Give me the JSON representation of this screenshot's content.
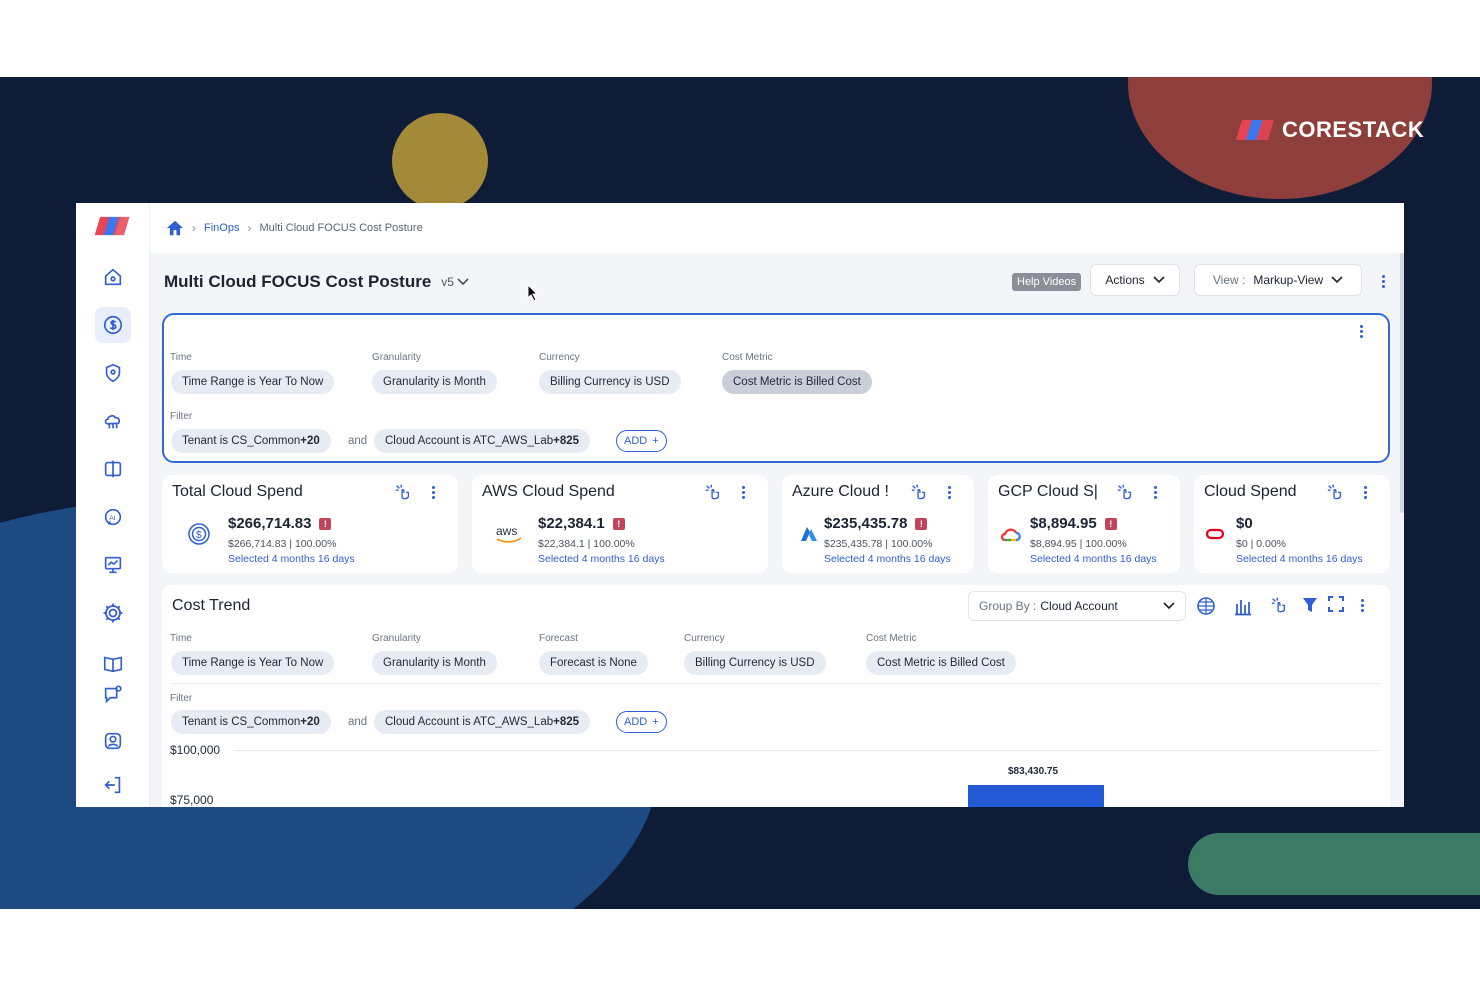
{
  "brand": {
    "name": "CORESTACK"
  },
  "breadcrumb": {
    "home_icon": "home-icon",
    "items": [
      "FinOps",
      "Multi Cloud FOCUS Cost Posture"
    ]
  },
  "page": {
    "title": "Multi Cloud FOCUS Cost Posture",
    "version": "v5",
    "help_videos": "Help Videos",
    "actions_label": "Actions",
    "view_prefix": "View :",
    "view_value": "Markup-View"
  },
  "sidebar": {
    "icons": [
      "home-icon",
      "dollar-icon",
      "shield-icon",
      "cloud-network-icon",
      "book-split-icon",
      "ai-chat-icon",
      "monitor-chart-icon",
      "gear-icon",
      "book-open-icon",
      "chat-settings-icon",
      "user-icon",
      "logout-icon"
    ],
    "active": "dollar-icon"
  },
  "filters": {
    "time_label": "Time",
    "time_chip": "Time Range is Year To Now",
    "granularity_label": "Granularity",
    "granularity_chip": "Granularity is Month",
    "currency_label": "Currency",
    "currency_chip": "Billing Currency is USD",
    "cost_metric_label": "Cost Metric",
    "cost_metric_chip": "Cost Metric is Billed Cost",
    "filter_label": "Filter",
    "tenant_chip_prefix": "Tenant is CS_Common",
    "tenant_chip_more": "+20",
    "and": "and",
    "account_chip_prefix": "Cloud Account is ATC_AWS_Lab",
    "account_chip_more": "+825",
    "add_label": "ADD"
  },
  "cards": [
    {
      "title": "Total Cloud Spend",
      "value": "$266,714.83",
      "sub": "$266,714.83 | 100.00%",
      "selected": "Selected 4 months 16 days",
      "logo": "dollar-circle-icon"
    },
    {
      "title": "AWS Cloud Spend",
      "value": "$22,384.1",
      "sub": "$22,384.1 | 100.00%",
      "selected": "Selected 4 months 16 days",
      "logo": "aws-logo",
      "logo_text": "aws"
    },
    {
      "title": "Azure Cloud !",
      "value": "$235,435.78",
      "sub": "$235,435.78 | 100.00%",
      "selected": "Selected 4 months 16 days",
      "logo": "azure-logo"
    },
    {
      "title": "GCP Cloud S|",
      "value": "$8,894.95",
      "sub": "$8,894.95 | 100.00%",
      "selected": "Selected 4 months 16 days",
      "logo": "gcp-logo"
    },
    {
      "title": "Cloud Spend",
      "value": "$0",
      "sub": "$0 | 0.00%",
      "selected": "Selected 4 months 16 days",
      "logo": "oracle-logo"
    }
  ],
  "cost_trend": {
    "title": "Cost Trend",
    "group_by_prefix": "Group By :",
    "group_by_value": "Cloud Account",
    "time_label": "Time",
    "time_chip": "Time Range is Year To Now",
    "granularity_label": "Granularity",
    "granularity_chip": "Granularity is Month",
    "forecast_label": "Forecast",
    "forecast_chip": "Forecast is None",
    "currency_label": "Currency",
    "currency_chip": "Billing Currency is USD",
    "cost_metric_label": "Cost Metric",
    "cost_metric_chip": "Cost Metric is Billed Cost",
    "filter_label": "Filter",
    "tenant_chip_prefix": "Tenant is CS_Common",
    "tenant_chip_more": "+20",
    "and": "and",
    "account_chip_prefix": "Cloud Account is ATC_AWS_Lab",
    "account_chip_more": "+825",
    "add_label": "ADD",
    "y_ticks": [
      "$100,000",
      "$75,000"
    ],
    "bar_label": "$83,430.75"
  },
  "colors": {
    "accent": "#2f5fd0",
    "primary_bar": "#2459d6",
    "background": "#0f1c38"
  }
}
